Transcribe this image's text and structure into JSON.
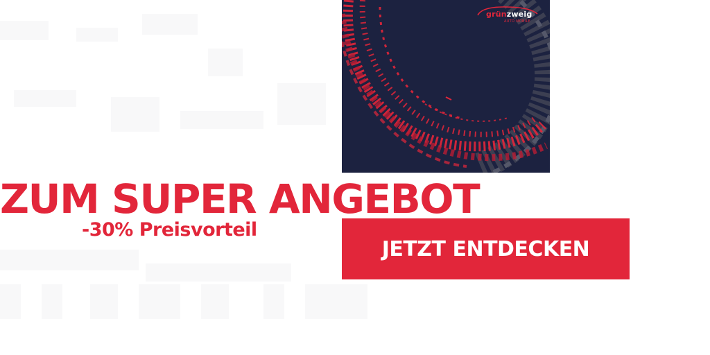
{
  "promo": {
    "image_alt": "Reifenspur auf dunkelblauem Hintergrund",
    "logo": {
      "brand_prefix": "grün",
      "brand_suffix": "zweig",
      "tagline": "AUTO MOBILE"
    },
    "headline": "ZUM SUPER ANGEBOT",
    "discount": "-30% Preisvorteil",
    "cta_label": "JETZT ENTDECKEN"
  },
  "colors": {
    "accent": "#e2263a",
    "image_bg": "#1c2240",
    "background": "#ffffff"
  }
}
